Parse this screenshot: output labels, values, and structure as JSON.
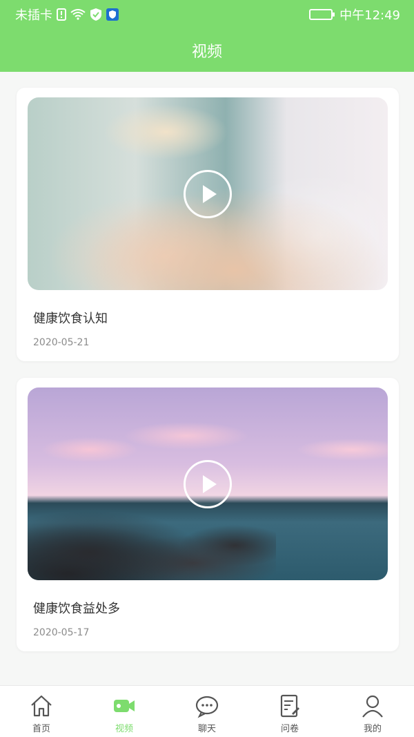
{
  "status_bar": {
    "carrier": "未插卡",
    "time": "中午12:49",
    "icons": [
      "sim-alert-icon",
      "wifi-icon",
      "shield-check-icon",
      "security-app-icon",
      "battery-charging-icon"
    ]
  },
  "header": {
    "title": "视频"
  },
  "videos": [
    {
      "title": "健康饮食认知",
      "date": "2020-05-21",
      "thumbnail": "hands-with-shadow-image"
    },
    {
      "title": "健康饮食益处多",
      "date": "2020-05-17",
      "thumbnail": "sea-and-rocks-image"
    }
  ],
  "tabbar": {
    "items": [
      {
        "label": "首页",
        "icon": "home-icon"
      },
      {
        "label": "视频",
        "icon": "video-camera-icon",
        "active": true
      },
      {
        "label": "聊天",
        "icon": "chat-bubble-icon"
      },
      {
        "label": "问卷",
        "icon": "questionnaire-icon"
      },
      {
        "label": "我的",
        "icon": "user-icon"
      }
    ]
  },
  "colors": {
    "accent": "#7ddc6e",
    "text": "#333333",
    "muted": "#8b8b8b"
  }
}
